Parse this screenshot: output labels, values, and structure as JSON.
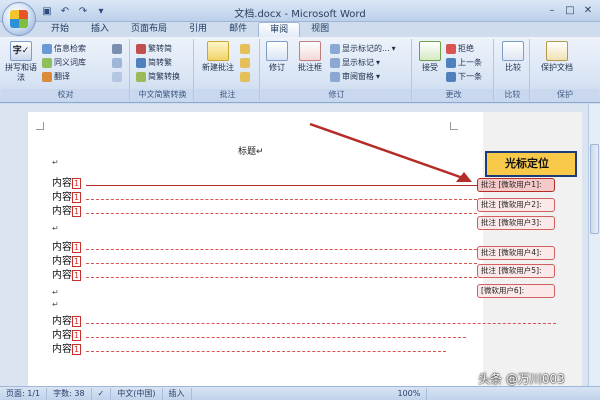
{
  "window": {
    "title": "文档.docx - Microsoft Word"
  },
  "tabs": [
    "开始",
    "插入",
    "页面布局",
    "引用",
    "邮件",
    "审阅",
    "视图"
  ],
  "active_tab": "审阅",
  "ribbon": {
    "proofing": {
      "label": "校对",
      "big_button": "拼写和语法",
      "items": [
        "信息检索",
        "同义词库",
        "翻译"
      ]
    },
    "chinese_conversion": {
      "label": "中文简繁转换",
      "items": [
        "繁转简",
        "简转繁",
        "简繁转换"
      ]
    },
    "comments": {
      "label": "批注",
      "big_button": "新建批注"
    },
    "tracking": {
      "label": "修订",
      "buttons": [
        "修订",
        "批注框"
      ],
      "dropdowns": [
        "显示标记的...",
        "显示标记",
        "审阅窗格"
      ]
    },
    "changes": {
      "label": "更改",
      "accept": "接受",
      "items": [
        "拒绝",
        "上一条",
        "下一条"
      ]
    },
    "compare": {
      "label": "比较",
      "button": "比较"
    },
    "protect": {
      "label": "保护",
      "button": "保护文档"
    }
  },
  "document": {
    "heading": "标题",
    "line_label": "内容",
    "line_marker": "1",
    "paragraph_mark": "↵",
    "annotation": "光标定位",
    "balloons": [
      "批注 [微软用户1]:",
      "批注 [微软用户2]:",
      "批注 [微软用户3]:",
      "批注 [微软用户4]:",
      "批注 [微软用户5]:",
      "[微软用户6]:"
    ]
  },
  "status_bar": {
    "page": "页面: 1/1",
    "words": "字数: 38",
    "language": "中文(中国)",
    "mode": "插入",
    "zoom": "100%"
  },
  "watermark": "头条 @万川003",
  "colors": {
    "revision_red": "#c9302c",
    "callout_fill": "#f9c94a",
    "ribbon_blue": "#d7e3f3"
  }
}
